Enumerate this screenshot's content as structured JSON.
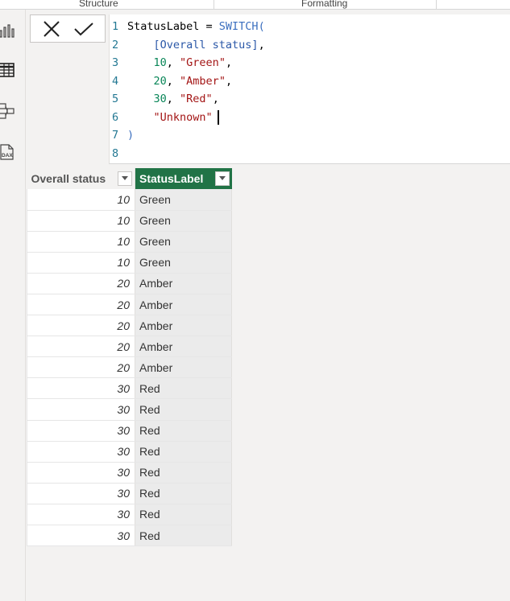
{
  "ribbon": {
    "groups": [
      {
        "label": "Structure"
      },
      {
        "label": "Formatting"
      }
    ]
  },
  "nav": {
    "items": [
      {
        "name": "report-view",
        "icon": "bar-chart-icon"
      },
      {
        "name": "table-view",
        "icon": "table-grid-icon"
      },
      {
        "name": "model-view",
        "icon": "model-diagram-icon"
      },
      {
        "name": "dax-query-view",
        "icon": "dax-icon"
      }
    ]
  },
  "formula_bar": {
    "cancel_icon": "close-icon",
    "commit_icon": "checkmark-icon",
    "lines": [
      {
        "n": "1",
        "tokens": [
          {
            "t": "StatusLabel = ",
            "c": "plain"
          },
          {
            "t": "SWITCH(",
            "c": "kw"
          }
        ]
      },
      {
        "n": "2",
        "tokens": [
          {
            "t": "    ",
            "c": "plain"
          },
          {
            "t": "[Overall status]",
            "c": "col"
          },
          {
            "t": ",",
            "c": "plain"
          }
        ]
      },
      {
        "n": "3",
        "tokens": [
          {
            "t": "    ",
            "c": "plain"
          },
          {
            "t": "10",
            "c": "num"
          },
          {
            "t": ", ",
            "c": "plain"
          },
          {
            "t": "\"Green\"",
            "c": "str"
          },
          {
            "t": ",",
            "c": "plain"
          }
        ]
      },
      {
        "n": "4",
        "tokens": [
          {
            "t": "    ",
            "c": "plain"
          },
          {
            "t": "20",
            "c": "num"
          },
          {
            "t": ", ",
            "c": "plain"
          },
          {
            "t": "\"Amber\"",
            "c": "str"
          },
          {
            "t": ",",
            "c": "plain"
          }
        ]
      },
      {
        "n": "5",
        "tokens": [
          {
            "t": "    ",
            "c": "plain"
          },
          {
            "t": "30",
            "c": "num"
          },
          {
            "t": ", ",
            "c": "plain"
          },
          {
            "t": "\"Red\"",
            "c": "str"
          },
          {
            "t": ",",
            "c": "plain"
          }
        ]
      },
      {
        "n": "6",
        "tokens": [
          {
            "t": "    ",
            "c": "plain"
          },
          {
            "t": "\"Unknown\"",
            "c": "str"
          }
        ],
        "cursor": true
      },
      {
        "n": "7",
        "tokens": [
          {
            "t": ")",
            "c": "kw"
          }
        ]
      },
      {
        "n": "8",
        "tokens": []
      }
    ]
  },
  "table": {
    "columns": [
      {
        "label": "Overall status"
      },
      {
        "label": "StatusLabel"
      }
    ],
    "rows": [
      [
        "10",
        "Green"
      ],
      [
        "10",
        "Green"
      ],
      [
        "10",
        "Green"
      ],
      [
        "10",
        "Green"
      ],
      [
        "20",
        "Amber"
      ],
      [
        "20",
        "Amber"
      ],
      [
        "20",
        "Amber"
      ],
      [
        "20",
        "Amber"
      ],
      [
        "20",
        "Amber"
      ],
      [
        "30",
        "Red"
      ],
      [
        "30",
        "Red"
      ],
      [
        "30",
        "Red"
      ],
      [
        "30",
        "Red"
      ],
      [
        "30",
        "Red"
      ],
      [
        "30",
        "Red"
      ],
      [
        "30",
        "Red"
      ],
      [
        "30",
        "Red"
      ]
    ]
  },
  "colors": {
    "selected_column_header": "#217346",
    "selected_column_cells": "#ebebeb",
    "keyword": "#3b6fbf",
    "string": "#a31515",
    "number": "#098658"
  }
}
